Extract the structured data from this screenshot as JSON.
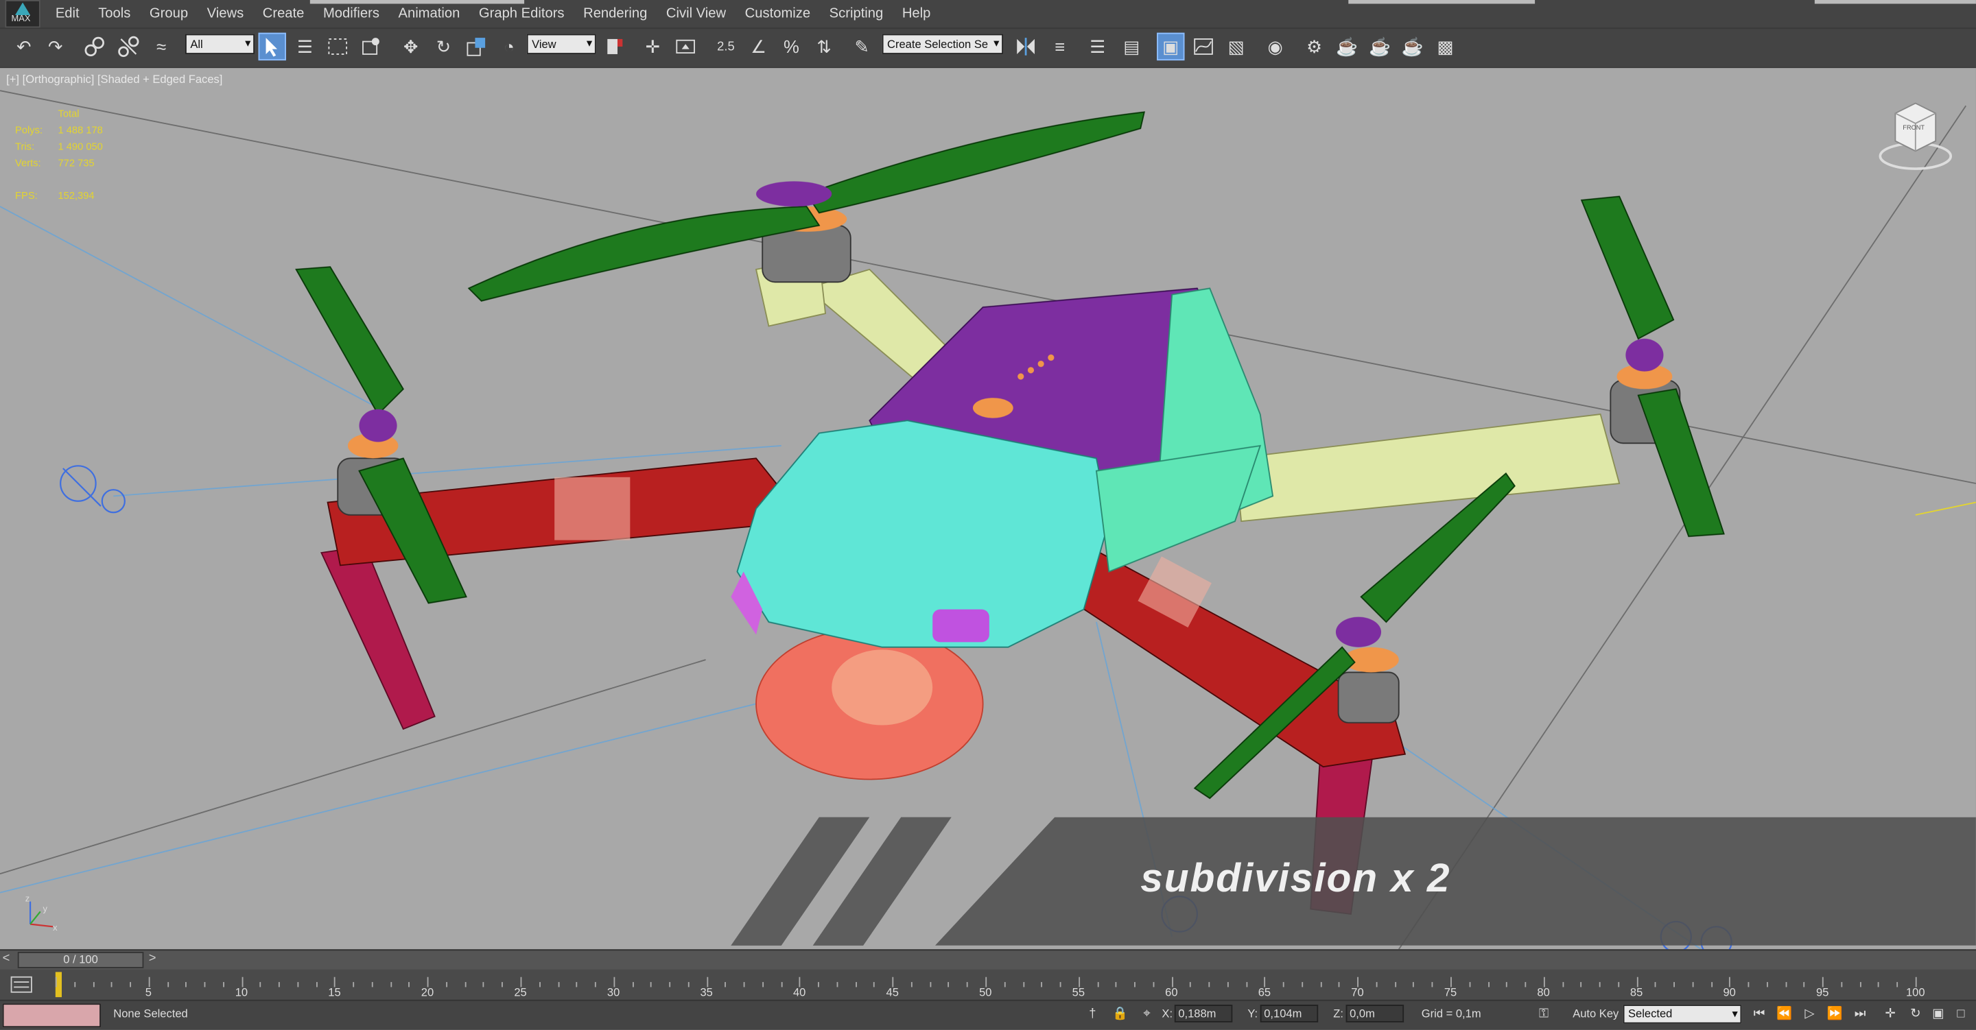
{
  "app": {
    "logo_text": "MAX"
  },
  "menu": [
    "Edit",
    "Tools",
    "Group",
    "Views",
    "Create",
    "Modifiers",
    "Animation",
    "Graph Editors",
    "Rendering",
    "Civil View",
    "Customize",
    "Scripting",
    "Help"
  ],
  "toolbar": {
    "selection_filter": "All",
    "ref_coord": "View",
    "snap_label": "2.5",
    "named_selection_placeholder": "Create Selection Se"
  },
  "viewport": {
    "label": "[+] [Orthographic] [Shaded + Edged Faces]",
    "viewcube_label": "FRONT",
    "stats": {
      "header": "Total",
      "rows": [
        {
          "key": "Polys:",
          "value": "1 488 178"
        },
        {
          "key": "Tris:",
          "value": "1 490 050"
        },
        {
          "key": "Verts:",
          "value": "772 735"
        },
        {
          "key": "FPS:",
          "value": "152,394"
        }
      ]
    },
    "overlay_text": "subdivision x 2",
    "colors": {
      "background": "#a8a8a8",
      "propellers": "#1e7a1e",
      "body_top": "#7d2ea0",
      "front_shell": "#5fe6d6",
      "front_arms": "#b82020",
      "rear_arms": "#dfe8a8",
      "legs": "#b01a4c",
      "camera": "#f07060",
      "motors": "#7a7a7a"
    }
  },
  "timeline": {
    "slider": "0 / 100",
    "ticks": [
      5,
      10,
      15,
      20,
      25,
      30,
      35,
      40,
      45,
      50,
      55,
      60,
      65,
      70,
      75,
      80,
      85,
      90,
      95,
      100
    ]
  },
  "status": {
    "selection": "None Selected",
    "x": "0,188m",
    "y": "0,104m",
    "z": "0,0m",
    "grid": "Grid = 0,1m",
    "auto_key": "Auto Key",
    "key_filter": "Selected"
  }
}
